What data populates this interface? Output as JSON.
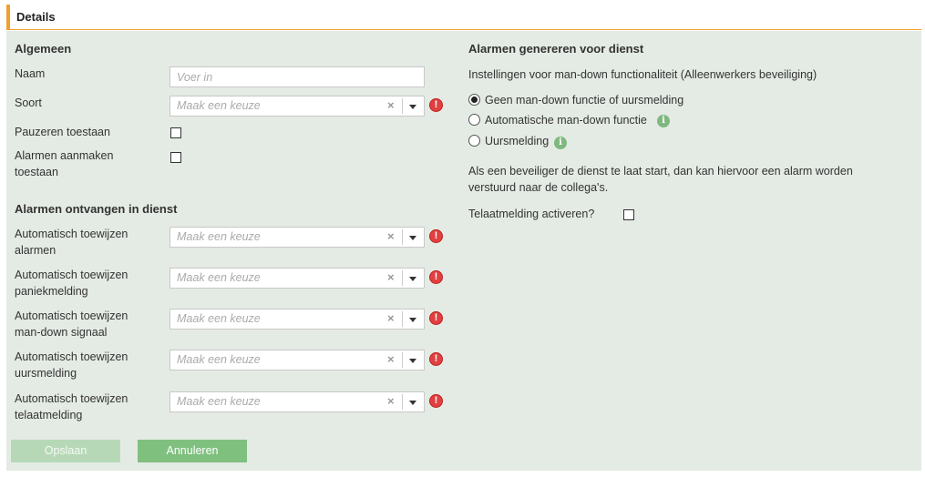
{
  "header": {
    "title": "Details"
  },
  "left": {
    "general_title": "Algemeen",
    "name_label": "Naam",
    "name_placeholder": "Voer in",
    "type_label": "Soort",
    "select_placeholder": "Maak een keuze",
    "pause_label": "Pauzeren toestaan",
    "create_alarms_label_1": "Alarmen aanmaken",
    "create_alarms_label_2": "toestaan",
    "receive_title": "Alarmen ontvangen in dienst",
    "assign_rows": [
      {
        "line1": "Automatisch toewijzen",
        "line2": "alarmen"
      },
      {
        "line1": "Automatisch toewijzen",
        "line2": "paniekmelding"
      },
      {
        "line1": "Automatisch toewijzen",
        "line2": "man-down signaal"
      },
      {
        "line1": "Automatisch toewijzen",
        "line2": "uursmelding"
      },
      {
        "line1": "Automatisch toewijzen",
        "line2": "telaatmelding"
      }
    ]
  },
  "right": {
    "generate_title": "Alarmen genereren voor dienst",
    "settings_text": "Instellingen voor man-down functionaliteit (Alleenwerkers beveiliging)",
    "radio_options": [
      {
        "label": "Geen man-down functie of uursmelding",
        "checked": true
      },
      {
        "label": "Automatische man-down functie",
        "checked": false
      },
      {
        "label": "Uursmelding",
        "checked": false
      }
    ],
    "late_text_1": "Als een beveiliger de dienst te laat start, dan kan hiervoor een alarm worden",
    "late_text_2": "verstuurd naar de collega's.",
    "late_label": "Telaatmelding activeren?"
  },
  "buttons": {
    "save": "Opslaan",
    "cancel": "Annuleren"
  },
  "icons": {
    "error": "error-icon",
    "info": "info-icon",
    "clear": "clear-icon",
    "dropdown": "chevron-down-icon"
  },
  "colors": {
    "accent": "#f0a030",
    "panel": "#e4ebe4",
    "error": "#e04040",
    "button": "#7fc07f"
  }
}
